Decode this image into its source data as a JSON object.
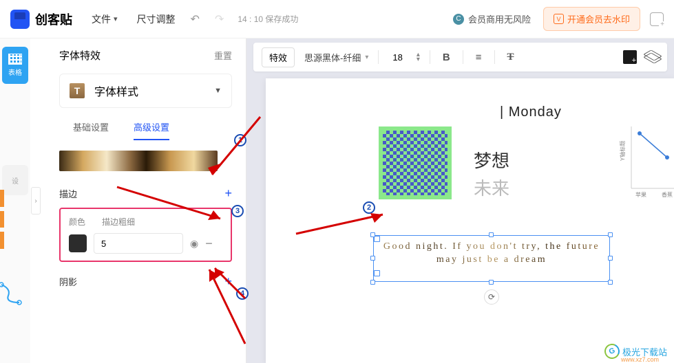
{
  "header": {
    "brand": "创客贴",
    "file_menu": "文件",
    "size_menu": "尺寸调整",
    "save_status": "14 : 10 保存成功",
    "member_text": "会员商用无风险",
    "vip_button": "开通会员去水印",
    "vip_badge": "V",
    "c_badge": "C"
  },
  "left_tools": {
    "active_label": "表格",
    "dim_label": "设"
  },
  "panel": {
    "title": "字体特效",
    "reset": "重置",
    "font_style": "字体样式",
    "tab_basic": "基础设置",
    "tab_advanced": "高级设置",
    "stroke_title": "描边",
    "color_label": "颜色",
    "thickness_label": "描边粗细",
    "thickness_value": "5",
    "shadow_title": "阴影"
  },
  "toolbar": {
    "effect_btn": "特效",
    "font_name": "思源黑体-纤细",
    "font_size": "18",
    "bold": "B"
  },
  "canvas": {
    "monday": "| Monday",
    "dream": "梦想",
    "future": "未来",
    "selected_text": "Good night. If you don't try, the future may just be a dream",
    "y_axis": "Y轴标题"
  },
  "badges": {
    "b1": "1",
    "b2": "2",
    "b3": "3",
    "b4": "4"
  },
  "watermark": {
    "name": "极光下载站",
    "url": "www.xz7.com",
    "logo": "G"
  },
  "chart_data": {
    "type": "line",
    "x": [
      "苹果",
      "香蕉"
    ],
    "values": [
      400,
      240
    ],
    "ylim": [
      0,
      450
    ],
    "ylabel": "Y轴标题"
  }
}
